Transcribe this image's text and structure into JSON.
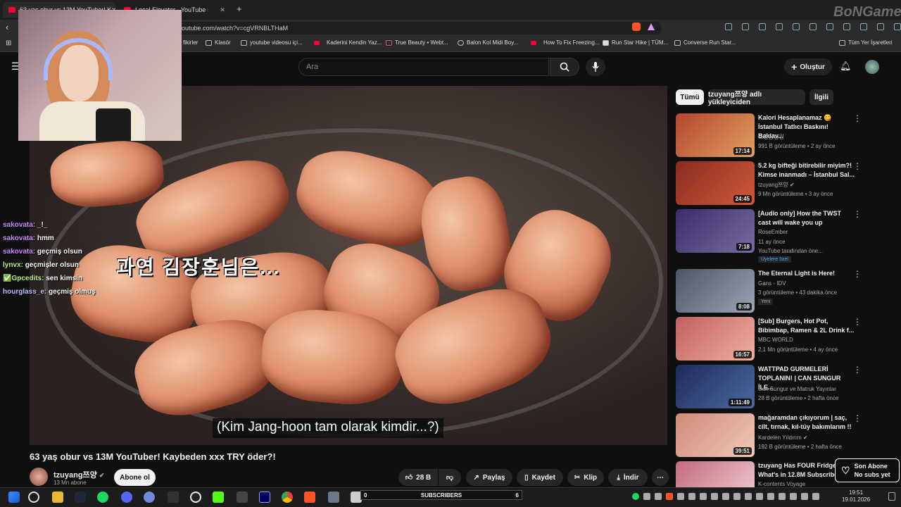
{
  "browser": {
    "tabs": [
      {
        "label": "63 yaş obur vs 13M YouTuber! K"
      },
      {
        "label": "Local Elevator - YouTube"
      }
    ],
    "url": "outube.com/watch?v=cgVRNBLTHaM",
    "bookmarks": [
      "fikirler",
      "Klasör",
      "youtube videosu içi...",
      "Kaderini Kendin Yaz...",
      "True Beauty • Webt...",
      "Balon Kol Midi Boy...",
      "How To Fix Freezing...",
      "Run Star Hike | TÜM...",
      "Converse Run Star..."
    ],
    "all_bookmarks": "Tüm Yer İşaretleri",
    "watermark": "BoNGame"
  },
  "header": {
    "search_placeholder": "Ara",
    "create_label": "Oluştur"
  },
  "video": {
    "korean_text": "과연 김장훈님은...",
    "caption": "(Kim Jang-hoon tam olarak kimdir...?)",
    "title": "63 yaş obur vs 13M YouTuber! Kaybeden xxx TRY öder?!",
    "channel": "tzuyang쯔양",
    "subscribers": "13 Mn abone",
    "subscribe_label": "Abone ol",
    "likes": "28 B",
    "share_label": "Paylaş",
    "save_label": "Kaydet",
    "clip_label": "Klip",
    "download_label": "İndir"
  },
  "chat": [
    {
      "user": "sakovata:",
      "msg": "_!_",
      "color": "#c78bff"
    },
    {
      "user": "sakovata:",
      "msg": "hmm",
      "color": "#c78bff"
    },
    {
      "user": "sakovata:",
      "msg": "geçmiş olsun",
      "color": "#c78bff"
    },
    {
      "user": "lynvx:",
      "msg": "geçmişler olsun",
      "color": "#b6f08a"
    },
    {
      "user": "Gpcedits:",
      "msg": "sen kimsin",
      "color": "#b6f08a"
    },
    {
      "user": "hourglass_e:",
      "msg": "geçmiş olmuş",
      "color": "#bfbfff"
    }
  ],
  "sidebar": {
    "chips": [
      "Tümü",
      "tzuyang쯔양 adlı yükleyiciden",
      "İlgili"
    ],
    "items": [
      {
        "title": "Kalori Hesaplanamaz 😋 İstanbul Tatlıcı Baskını! Baklav...",
        "channel": "쯔양팡정원",
        "meta": "991 B görüntüleme • 2 ay önce",
        "duration": "17:14",
        "thumb": "#b5452f"
      },
      {
        "title": "5.2 kg bifteği bitirebilir miyim?! Kimse inanmadı – İstanbul Sal...",
        "channel": "tzuyang쯔양 ✔",
        "meta": "9 Mn görüntüleme • 3 ay önce",
        "duration": "24:45",
        "thumb": "#8a2b1f"
      },
      {
        "title": "[Audio only] How the TWST cast will wake you up",
        "channel": "RoseEmber",
        "meta": "11 ay önce",
        "duration": "7:18",
        "thumb": "#3b2d6b",
        "extra": "YouTube tarafından öne...",
        "badge": "Üyelere özel"
      },
      {
        "title": "The Eternal Light is Here!",
        "channel": "Gans - IDV",
        "meta": "3 görüntüleme • 43 dakika önce",
        "duration": "8:08",
        "thumb": "#4a5566",
        "badge": "Yeni"
      },
      {
        "title": "[Sub] Burgers, Hot Pot, Bibimbap, Ramen & 2L Drink f...",
        "channel": "MBC WORLD",
        "meta": "2,1 Mn görüntüleme • 4 ay önce",
        "duration": "16:57",
        "thumb": "#c06060"
      },
      {
        "title": "WATTPAD GURMELERİ TOPLANIN! | CAN SUNGUR İLE...",
        "channel": "Can Sungur ve Matruk Yayınlar",
        "meta": "28 B görüntüleme • 2 hafta önce",
        "duration": "1:11:49",
        "thumb": "#1e2a5a"
      },
      {
        "title": "mağaramdan çıkıyorum | saç, cilt, tırnak, kıl-tüy bakımlarım !!",
        "channel": "Kardelen Yıldırım ✔",
        "meta": "192 B görüntüleme • 2 hafta önce",
        "duration": "39:51",
        "thumb": "#d08a7a"
      },
      {
        "title": "tzuyang Has FOUR Fridges! What's in 12.8M Subscribe...",
        "channel": "K-contents Voyage",
        "meta": "",
        "duration": "",
        "thumb": "#c46a7a"
      }
    ]
  },
  "overlay": {
    "son_abone": "Son Abone",
    "no_subs": "No subs yet",
    "subscribers_label": "SUBSCRIBERS",
    "sub_count_left": "0",
    "sub_count_right": "6"
  },
  "taskbar": {
    "time": "19:51",
    "date": "19.01.2026"
  }
}
